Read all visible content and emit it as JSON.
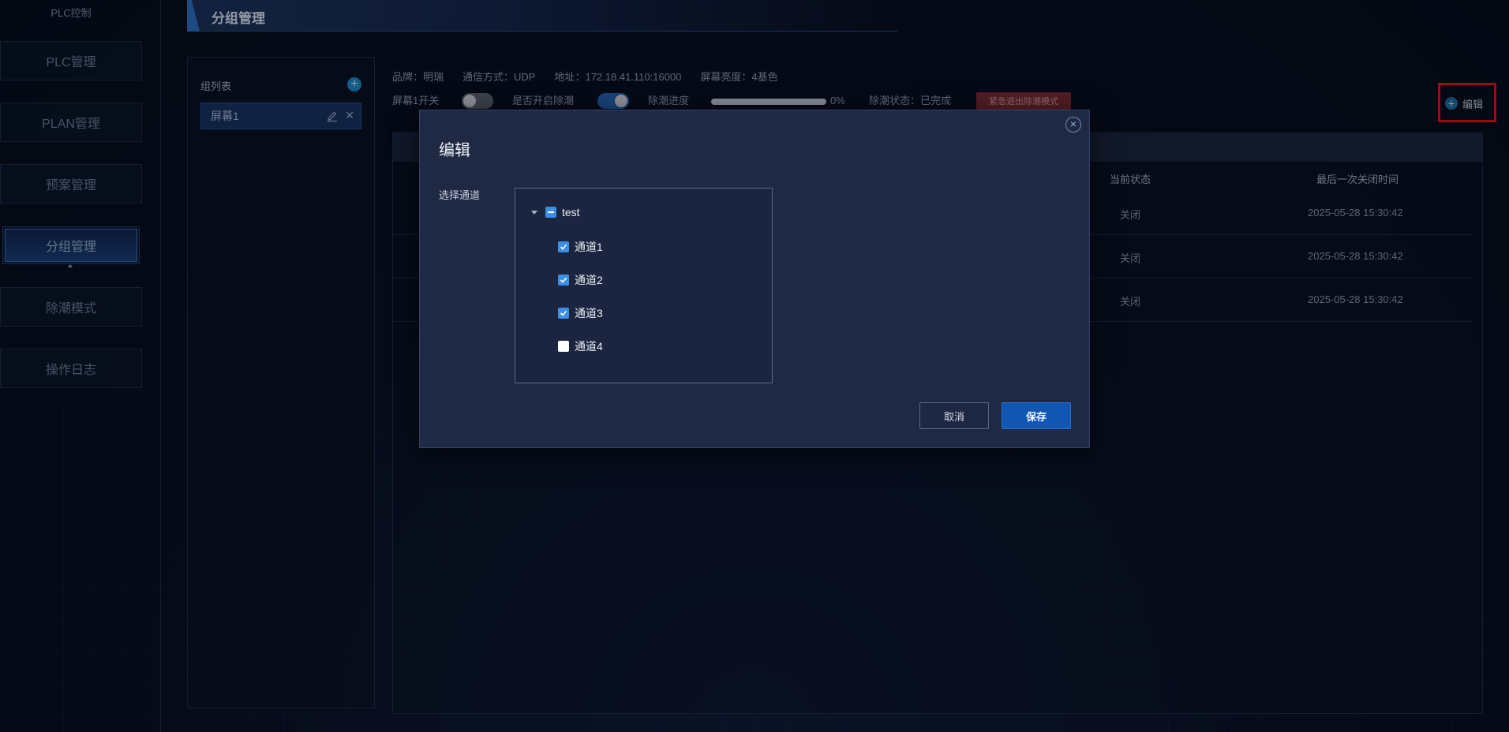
{
  "sidebar": {
    "title": "PLC控制",
    "items": [
      {
        "label": "PLC管理"
      },
      {
        "label": "PLAN管理"
      },
      {
        "label": "预案管理"
      },
      {
        "label": "分组管理"
      },
      {
        "label": "除潮模式"
      },
      {
        "label": "操作日志"
      }
    ],
    "active": "分组管理"
  },
  "header": {
    "title": "分组管理"
  },
  "group_panel": {
    "title": "组列表",
    "add_icon": "plus-circle-icon",
    "items": [
      {
        "label": "屏幕1"
      }
    ]
  },
  "device_info": {
    "brand": "品牌：明瑞",
    "protocol": "通信方式：UDP",
    "address": "地址：172.18.41.110:16000",
    "brightness": "屏幕亮度：4基色"
  },
  "controls": {
    "screen_switch_label": "屏幕1开关",
    "screen_switch_on": false,
    "dehumidify_label": "是否开启除潮",
    "dehumidify_on": true,
    "progress_label": "除潮进度",
    "progress_value": "0%",
    "progress_fraction": 0,
    "status": "除潮状态：已完成",
    "emergency_button": "紧急退出除潮模式",
    "edit_button": "编辑"
  },
  "table": {
    "headers": [
      "当前状态",
      "最后一次关闭时间"
    ],
    "rows": [
      {
        "status": "关闭",
        "time": "2025-05-28 15:30:42"
      },
      {
        "status": "关闭",
        "time": "2025-05-28 15:30:42"
      },
      {
        "status": "关闭",
        "time": "2025-05-28 15:30:42"
      }
    ]
  },
  "modal": {
    "title": "编辑",
    "field_label": "选择通道",
    "tree": {
      "root": {
        "label": "test",
        "state": "partial"
      },
      "children": [
        {
          "label": "通道1",
          "checked": true
        },
        {
          "label": "通道2",
          "checked": true
        },
        {
          "label": "通道3",
          "checked": true
        },
        {
          "label": "通道4",
          "checked": false
        }
      ]
    },
    "cancel": "取消",
    "save": "保存"
  },
  "colors": {
    "accent": "#1156b3",
    "checkbox": "#3b8fe4",
    "highlight_box": "#e01818",
    "emergency": "#7a2a2e"
  }
}
